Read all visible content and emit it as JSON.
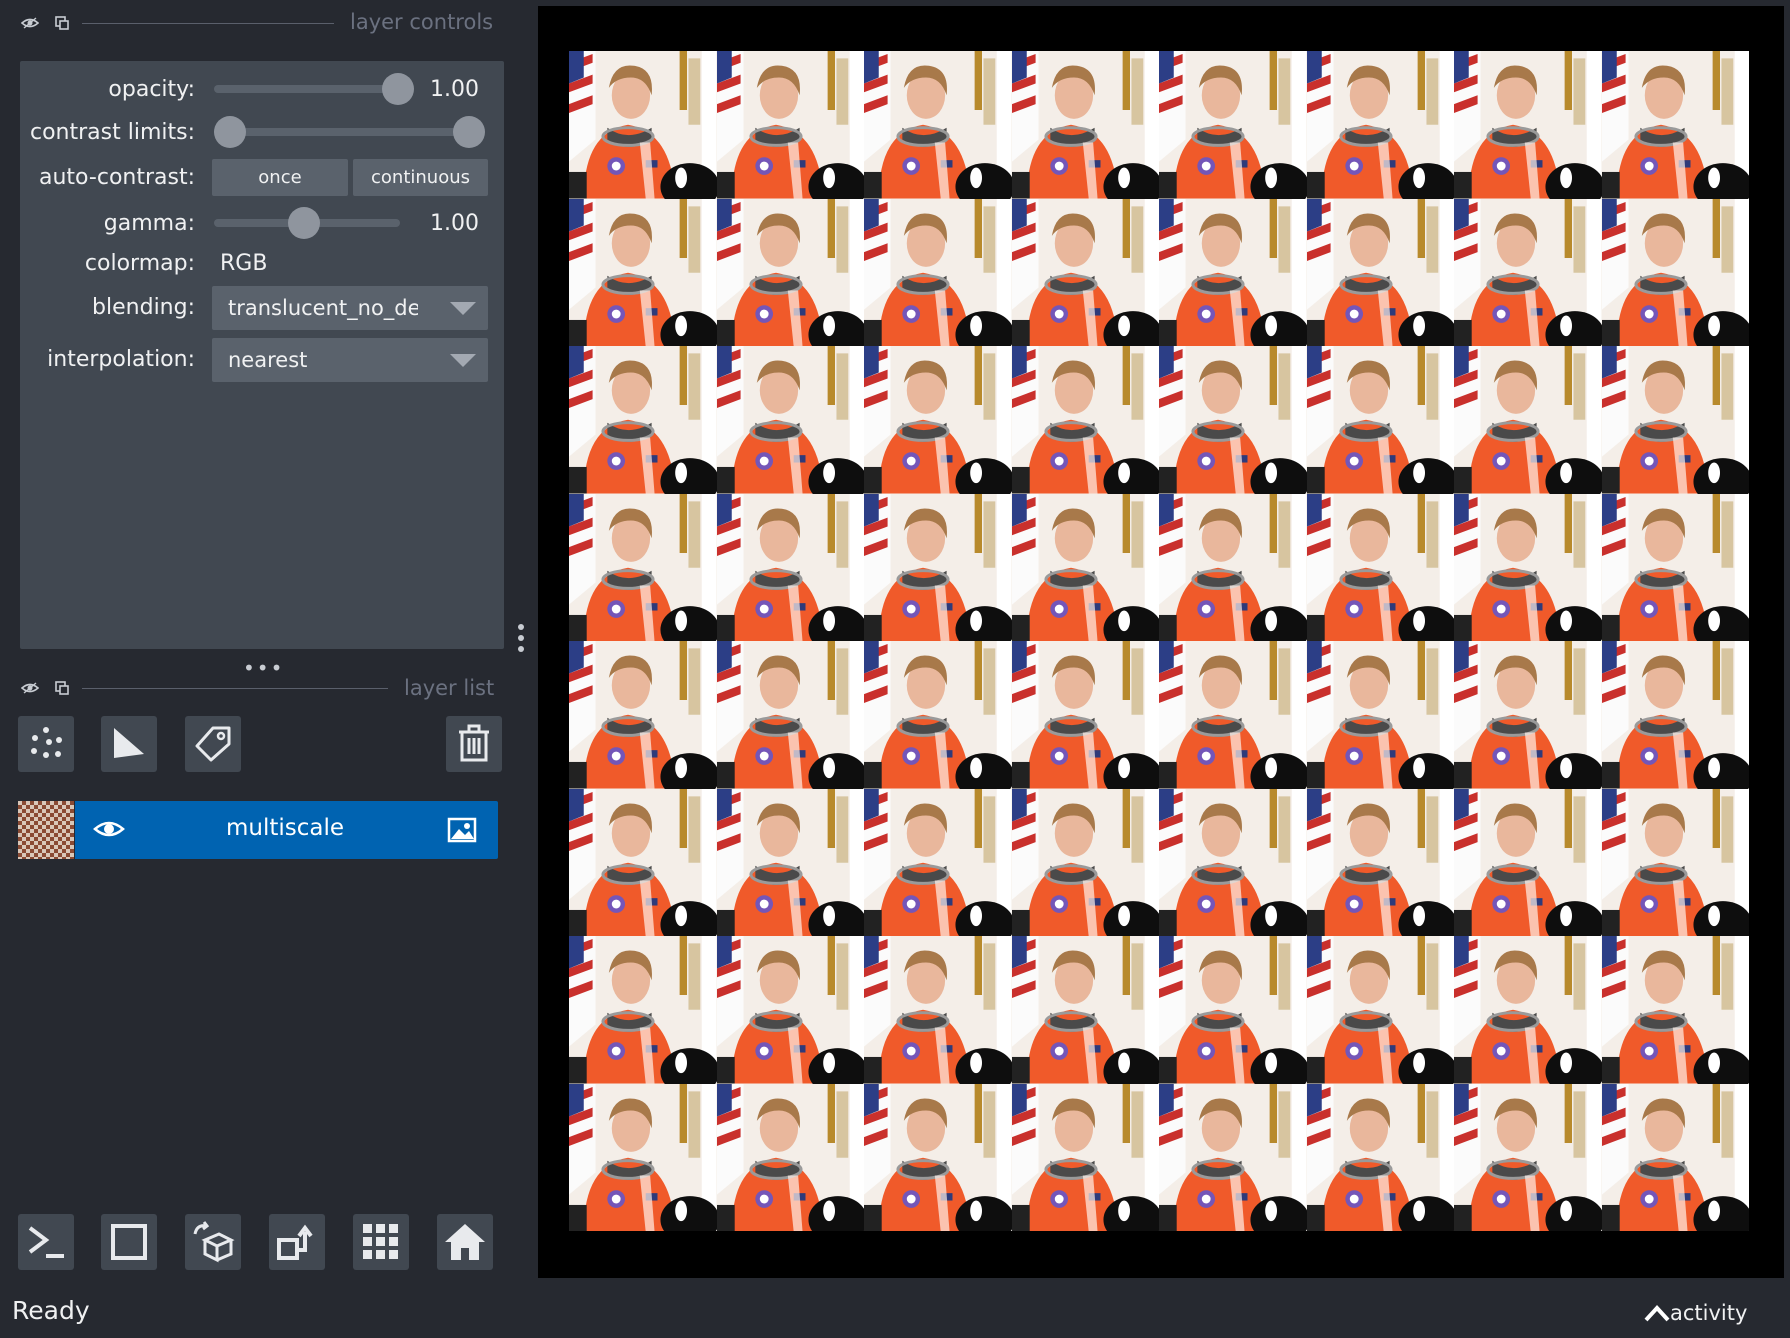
{
  "layer_controls": {
    "title": "layer controls",
    "opacity_label": "opacity:",
    "opacity_value": "1.00",
    "contrast_label": "contrast limits:",
    "autocontrast_label": "auto-contrast:",
    "once_label": "once",
    "continuous_label": "continuous",
    "gamma_label": "gamma:",
    "gamma_value": "1.00",
    "colormap_label": "colormap:",
    "colormap_value": "RGB",
    "blending_label": "blending:",
    "blending_value": "translucent_no_depth",
    "interpolation_label": "interpolation:",
    "interpolation_value": "nearest"
  },
  "layer_list": {
    "title": "layer list",
    "layers": [
      {
        "name": "multiscale",
        "visible": true,
        "type_icon": "image-icon"
      }
    ]
  },
  "status": {
    "text": "Ready",
    "activity_label": "activity"
  },
  "colors": {
    "background": "#262930",
    "panel": "#414851",
    "selected_layer": "#0063b1",
    "canvas": "#000000"
  }
}
